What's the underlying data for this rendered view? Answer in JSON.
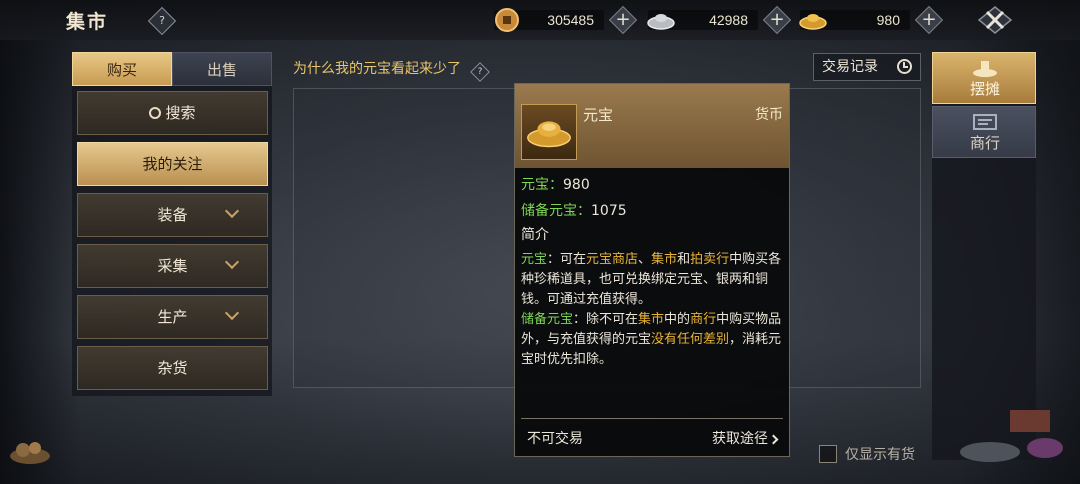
{
  "header": {
    "title": "集市",
    "help_mark": "?",
    "currencies": [
      {
        "icon": "copper-coin-icon",
        "value": "305485"
      },
      {
        "icon": "silver-ingot-icon",
        "value": "42988"
      },
      {
        "icon": "gold-yuanbao-icon",
        "value": "980"
      }
    ],
    "plus_label": "+"
  },
  "tabs": {
    "buy": "购买",
    "sell": "出售"
  },
  "sidebar": {
    "items": [
      {
        "label": "搜索"
      },
      {
        "label": "我的关注"
      },
      {
        "label": "装备"
      },
      {
        "label": "采集"
      },
      {
        "label": "生产"
      },
      {
        "label": "杂货"
      }
    ]
  },
  "notice": {
    "question": "为什么我的元宝看起来少了",
    "mark": "?"
  },
  "record_button": "交易记录",
  "right_nav": {
    "stall": "摆摊",
    "shop": "商行"
  },
  "filter": {
    "in_stock_only": "仅显示有货"
  },
  "tooltip": {
    "name": "元宝",
    "type": "货币",
    "amount_label": "元宝：",
    "amount": "980",
    "reserve_label": "储备元宝：",
    "reserve": "1075",
    "intro": "简介",
    "desc": {
      "p1_a": "元宝",
      "p1_b": "：可在",
      "p1_c": "元宝商店",
      "p1_d": "、",
      "p1_e": "集市",
      "p1_f": "和",
      "p1_g": "拍卖行",
      "p1_h": "中购买各种珍稀道具，也可兑换绑定元宝、银两和铜钱。可通过充值获得。",
      "p2_a": "储备元宝",
      "p2_b": "：除不可在",
      "p2_c": "集市",
      "p2_d": "中的",
      "p2_e": "商行",
      "p2_f": "中购买物品外，与充值获得的元宝",
      "p2_g": "没有任何差别",
      "p2_h": "，消耗元宝时优先扣除。"
    },
    "untradable": "不可交易",
    "get_path": "获取途径"
  },
  "colors": {
    "accent_gold": "#e8c46a",
    "green_text": "#7dd655",
    "yellow_text": "#e8b438"
  }
}
